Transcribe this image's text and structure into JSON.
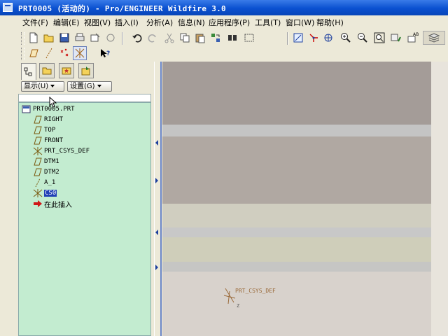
{
  "window": {
    "title": "PRT0005 (活动的) - Pro/ENGINEER Wildfire 3.0"
  },
  "menu": [
    {
      "label": "文件(F)"
    },
    {
      "label": "编辑(E)"
    },
    {
      "label": "视图(V)"
    },
    {
      "label": "插入(I)"
    },
    {
      "label": "分析(A)"
    },
    {
      "label": "信息(N)"
    },
    {
      "label": "应用程序(P)"
    },
    {
      "label": "工具(T)"
    },
    {
      "label": "窗口(W)"
    },
    {
      "label": "帮助(H)"
    }
  ],
  "toolbar_icons": [
    "new-icon",
    "open-icon",
    "save-icon",
    "print-icon",
    "send-icon",
    "erase-icon",
    "undo-icon",
    "redo-icon",
    "cut-icon",
    "copy-icon",
    "paste-icon",
    "regenerate-icon",
    "find-icon",
    "select-box-icon",
    "repaint-icon",
    "spin-center-icon",
    "orient-icon",
    "zoom-in-icon",
    "zoom-out-icon",
    "refit-icon",
    "saved-views-icon",
    "layers-icon"
  ],
  "datum_toolbar_icons": [
    "datum-plane-display-icon",
    "datum-axis-display-icon",
    "datum-point-display-icon",
    "csys-display-icon",
    "whats-this-icon"
  ],
  "model_tree": {
    "show_button": "显示(U)",
    "settings_button": "设置(G)",
    "items": [
      {
        "label": "PRT0005.PRT",
        "icon": "part-icon",
        "selected": false
      },
      {
        "label": "RIGHT",
        "icon": "datum-plane-icon",
        "selected": false
      },
      {
        "label": "TOP",
        "icon": "datum-plane-icon",
        "selected": false
      },
      {
        "label": "FRONT",
        "icon": "datum-plane-icon",
        "selected": false
      },
      {
        "label": "PRT_CSYS_DEF",
        "icon": "csys-icon",
        "selected": false
      },
      {
        "label": "DTM1",
        "icon": "datum-plane-icon",
        "selected": false
      },
      {
        "label": "DTM2",
        "icon": "datum-plane-icon",
        "selected": false
      },
      {
        "label": "A_1",
        "icon": "datum-axis-icon",
        "selected": false
      },
      {
        "label": "CS0",
        "icon": "csys-icon",
        "selected": true
      },
      {
        "label": "在此插入",
        "icon": "insert-here-icon",
        "selected": false
      }
    ]
  },
  "graphics": {
    "csys_label": "PRT_CSYS_DEF",
    "axis_label": "Z",
    "band_colors": [
      "#a49c98",
      "#c4c4c4",
      "#b0a8a2",
      "#d0cec0",
      "#c8c8c8",
      "#cfceba",
      "#c6c6c4",
      "#d8d2cc"
    ]
  }
}
